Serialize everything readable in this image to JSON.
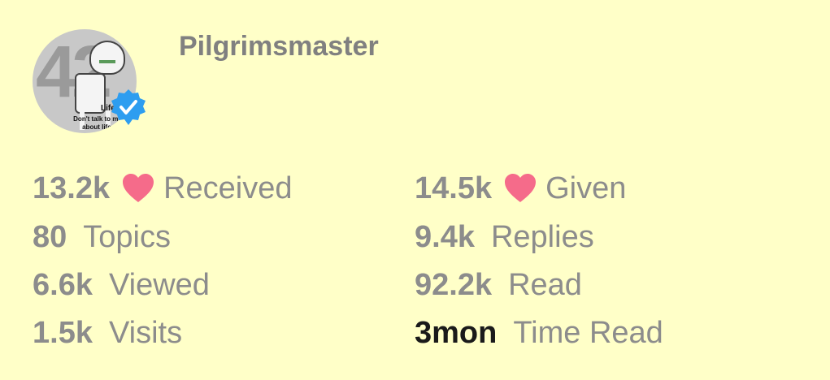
{
  "profile": {
    "username": "Pilgrimsmaster",
    "avatar": {
      "number": "42",
      "life_word": "Life",
      "caption_line1": "Don't talk to me",
      "caption_line2": "about life."
    },
    "badge_icon": "verified-check-icon"
  },
  "stats": {
    "received": {
      "value": "13.2k",
      "label": "Received",
      "icon": "heart-icon"
    },
    "given": {
      "value": "14.5k",
      "label": "Given",
      "icon": "heart-icon"
    },
    "topics": {
      "value": "80",
      "label": "Topics"
    },
    "replies": {
      "value": "9.4k",
      "label": "Replies"
    },
    "viewed": {
      "value": "6.6k",
      "label": "Viewed"
    },
    "read": {
      "value": "92.2k",
      "label": "Read"
    },
    "visits": {
      "value": "1.5k",
      "label": "Visits"
    },
    "time_read": {
      "value": "3mon",
      "label": "Time Read"
    }
  },
  "colors": {
    "background": "#ffffc8",
    "heart": "#f56b8a",
    "badge": "#2d9df0",
    "text_muted": "#8c8c8c",
    "text_dark": "#1a1a1a"
  }
}
